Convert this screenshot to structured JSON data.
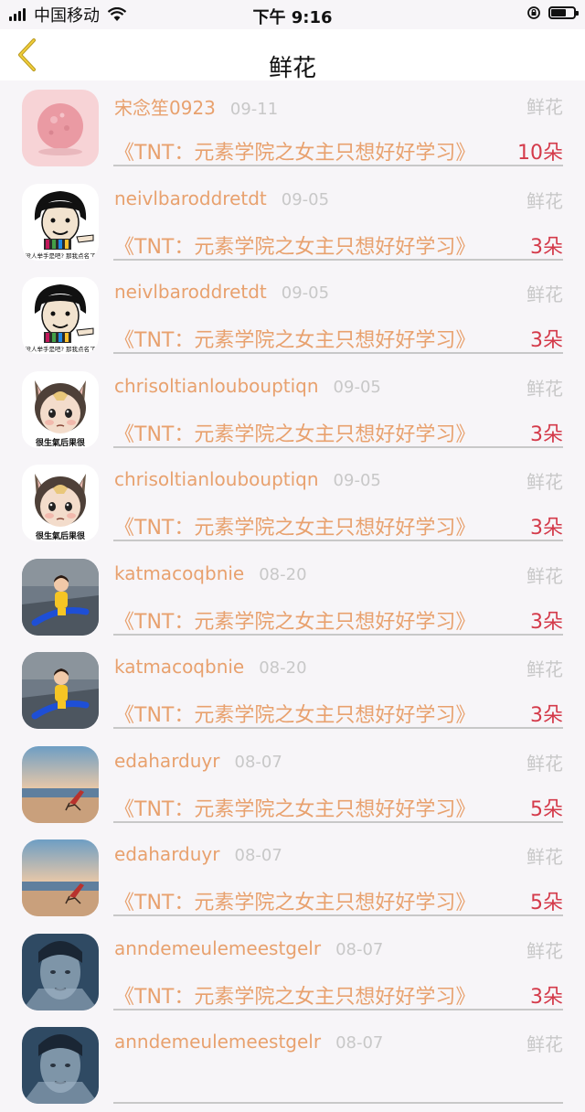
{
  "status_bar": {
    "carrier": "中国移动",
    "time": "下午 9:16"
  },
  "nav": {
    "title": "鲜花"
  },
  "avatar_texts": {
    "meme_a": "没人举手是吧? 那我点名了",
    "meme_b": "很生氣后果很"
  },
  "items": [
    {
      "user": "宋念笙0923",
      "date": "09-11",
      "type": "鲜花",
      "book": "《TNT：元素学院之女主只想好好学习》",
      "count": "10朵",
      "avatar": "pink"
    },
    {
      "user": "neivlbaroddretdt",
      "date": "09-05",
      "type": "鲜花",
      "book": "《TNT：元素学院之女主只想好好学习》",
      "count": "3朵",
      "avatar": "meme_a"
    },
    {
      "user": "neivlbaroddretdt",
      "date": "09-05",
      "type": "鲜花",
      "book": "《TNT：元素学院之女主只想好好学习》",
      "count": "3朵",
      "avatar": "meme_a"
    },
    {
      "user": "chrisoltianloubouptiqn",
      "date": "09-05",
      "type": "鲜花",
      "book": "《TNT：元素学院之女主只想好好学习》",
      "count": "3朵",
      "avatar": "meme_b"
    },
    {
      "user": "chrisoltianloubouptiqn",
      "date": "09-05",
      "type": "鲜花",
      "book": "《TNT：元素学院之女主只想好好学习》",
      "count": "3朵",
      "avatar": "meme_b"
    },
    {
      "user": "katmacoqbnie",
      "date": "08-20",
      "type": "鲜花",
      "book": "《TNT：元素学院之女主只想好好学习》",
      "count": "3朵",
      "avatar": "kid"
    },
    {
      "user": "katmacoqbnie",
      "date": "08-20",
      "type": "鲜花",
      "book": "《TNT：元素学院之女主只想好好学习》",
      "count": "3朵",
      "avatar": "kid"
    },
    {
      "user": "edaharduyr",
      "date": "08-07",
      "type": "鲜花",
      "book": "《TNT：元素学院之女主只想好好学习》",
      "count": "5朵",
      "avatar": "beach"
    },
    {
      "user": "edaharduyr",
      "date": "08-07",
      "type": "鲜花",
      "book": "《TNT：元素学院之女主只想好好学习》",
      "count": "5朵",
      "avatar": "beach"
    },
    {
      "user": "anndemeulemeestgelr",
      "date": "08-07",
      "type": "鲜花",
      "book": "《TNT：元素学院之女主只想好好学习》",
      "count": "3朵",
      "avatar": "face"
    },
    {
      "user": "anndemeulemeestgelr",
      "date": "08-07",
      "type": "鲜花",
      "book": "",
      "count": "",
      "avatar": "face"
    }
  ]
}
